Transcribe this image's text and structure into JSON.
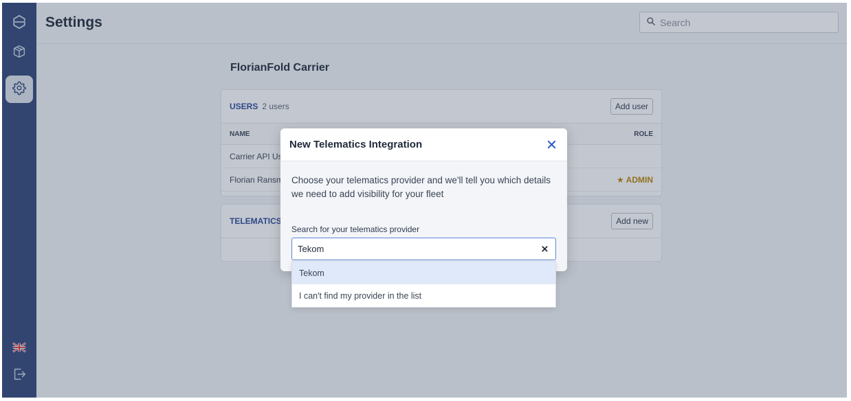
{
  "header": {
    "title": "Settings",
    "search_placeholder": "Search"
  },
  "sidebar": {
    "items": [
      {
        "name": "logo",
        "icon": "logo-icon"
      },
      {
        "name": "shipments",
        "icon": "box-icon"
      },
      {
        "name": "settings",
        "icon": "gear-icon",
        "active": true
      },
      {
        "name": "language",
        "icon": "uk-flag-icon"
      },
      {
        "name": "logout",
        "icon": "logout-icon"
      }
    ]
  },
  "main": {
    "company_name": "FlorianFold Carrier",
    "users_card": {
      "title": "USERS",
      "count": "2 users",
      "add_button": "Add user",
      "columns": [
        "NAME",
        "ROLE"
      ],
      "rows": [
        {
          "name": "Carrier API Us",
          "role": ""
        },
        {
          "name": "Florian Ransm",
          "role": "★ ADMIN"
        }
      ]
    },
    "telematics_card": {
      "title": "TELEMATICS",
      "add_button": "Add new"
    }
  },
  "modal": {
    "title": "New Telematics Integration",
    "description": "Choose your telematics provider and we'll tell you which details we need to add visibility for your fleet",
    "field_label": "Search for your telematics provider",
    "input_value": "Tekom",
    "options": [
      "Tekom",
      "I can't find my provider in the list"
    ]
  },
  "colors": {
    "sidebar": "#2e4677",
    "accent": "#2c4a9a",
    "admin": "#b8860b",
    "option_highlight": "#dfe9f9"
  }
}
